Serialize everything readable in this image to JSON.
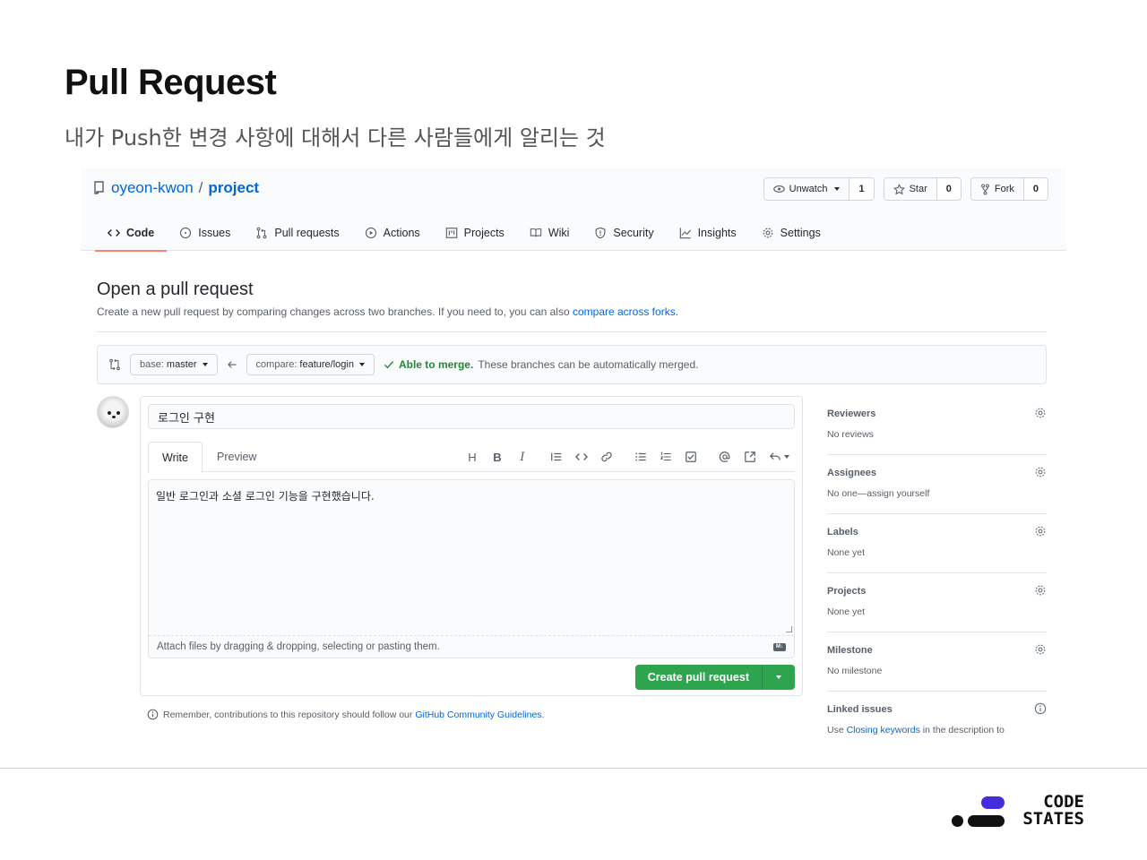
{
  "slide": {
    "title": "Pull Request",
    "subtitle": "내가 Push한 변경 사항에 대해서 다른 사람들에게 알리는 것"
  },
  "repo": {
    "owner": "oyeon-kwon",
    "slash": "/",
    "name": "project"
  },
  "head_actions": {
    "watch_label": "Unwatch",
    "watch_count": "1",
    "star_label": "Star",
    "star_count": "0",
    "fork_label": "Fork",
    "fork_count": "0"
  },
  "tabs": [
    {
      "label": "Code",
      "icon": "code-icon"
    },
    {
      "label": "Issues",
      "icon": "issue-icon"
    },
    {
      "label": "Pull requests",
      "icon": "pull-request-icon"
    },
    {
      "label": "Actions",
      "icon": "play-icon"
    },
    {
      "label": "Projects",
      "icon": "project-icon"
    },
    {
      "label": "Wiki",
      "icon": "book-icon"
    },
    {
      "label": "Security",
      "icon": "shield-icon"
    },
    {
      "label": "Insights",
      "icon": "graph-icon"
    },
    {
      "label": "Settings",
      "icon": "gear-icon"
    }
  ],
  "open_pr": {
    "title": "Open a pull request",
    "description": "Create a new pull request by comparing changes across two branches. If you need to, you can also ",
    "description_link": "compare across forks.",
    "base_label": "base:",
    "base_value": "master",
    "compare_label": "compare:",
    "compare_value": "feature/login",
    "merge_status_bold": "Able to merge.",
    "merge_status_text": "These branches can be automatically merged."
  },
  "form": {
    "title_value": "로그인 구현",
    "tab_write": "Write",
    "tab_preview": "Preview",
    "toolbar": {
      "heading": "H",
      "bold": "B",
      "italic": "I"
    },
    "body_value": "일반 로그인과 소셜 로그인 기능을 구현했습니다.",
    "attach_hint": "Attach files by dragging & dropping, selecting or pasting them.",
    "markdown_badge": "M↓",
    "create_button": "Create pull request",
    "guidelines_text": "Remember, contributions to this repository should follow our ",
    "guidelines_link": "GitHub Community Guidelines",
    "guidelines_end": "."
  },
  "sidebar": [
    {
      "label": "Reviewers",
      "value": "No reviews",
      "icon": "gear-icon"
    },
    {
      "label": "Assignees",
      "value": "No one—assign yourself",
      "icon": "gear-icon"
    },
    {
      "label": "Labels",
      "value": "None yet",
      "icon": "gear-icon"
    },
    {
      "label": "Projects",
      "value": "None yet",
      "icon": "gear-icon"
    },
    {
      "label": "Milestone",
      "value": "No milestone",
      "icon": "gear-icon"
    },
    {
      "label": "Linked issues",
      "value_prefix": "Use ",
      "value_link": "Closing keywords",
      "value_suffix": " in the description to",
      "icon": "info-icon"
    }
  ],
  "logo": {
    "line1": "CODE",
    "line2": "STATES"
  },
  "colors": {
    "link": "#0366d6",
    "merge_ok": "#22863a",
    "primary_button": "#2ea44f",
    "active_tab": "#f9826c",
    "logo_accent": "#452cdd"
  }
}
